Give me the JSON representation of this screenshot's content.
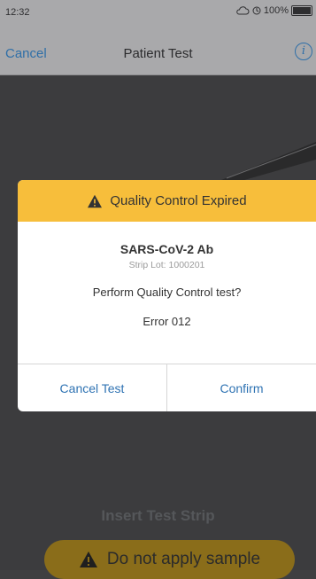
{
  "status_bar": {
    "time": "12:32",
    "battery": "100%",
    "icons": [
      "cloud-icon",
      "signal-icon",
      "battery-icon"
    ]
  },
  "nav": {
    "cancel_label": "Cancel",
    "title": "Patient Test",
    "info_icon": "info-icon"
  },
  "dialog": {
    "title": "Quality Control Expired",
    "header_icon": "warning-icon",
    "test_name": "SARS-CoV-2 Ab",
    "strip_lot": "Strip Lot: 1000201",
    "prompt": "Perform Quality Control test?",
    "error": "Error 012",
    "cancel_label": "Cancel Test",
    "confirm_label": "Confirm"
  },
  "background": {
    "instruction": "Insert Test Strip",
    "warning_text": "Do not apply sample",
    "warning_icon": "warning-icon"
  },
  "colors": {
    "accent_blue": "#2f73b3",
    "warning_yellow": "#f7be3b",
    "dim_warning": "#8a6d1a",
    "overlay_bg": "#3f3f41"
  }
}
